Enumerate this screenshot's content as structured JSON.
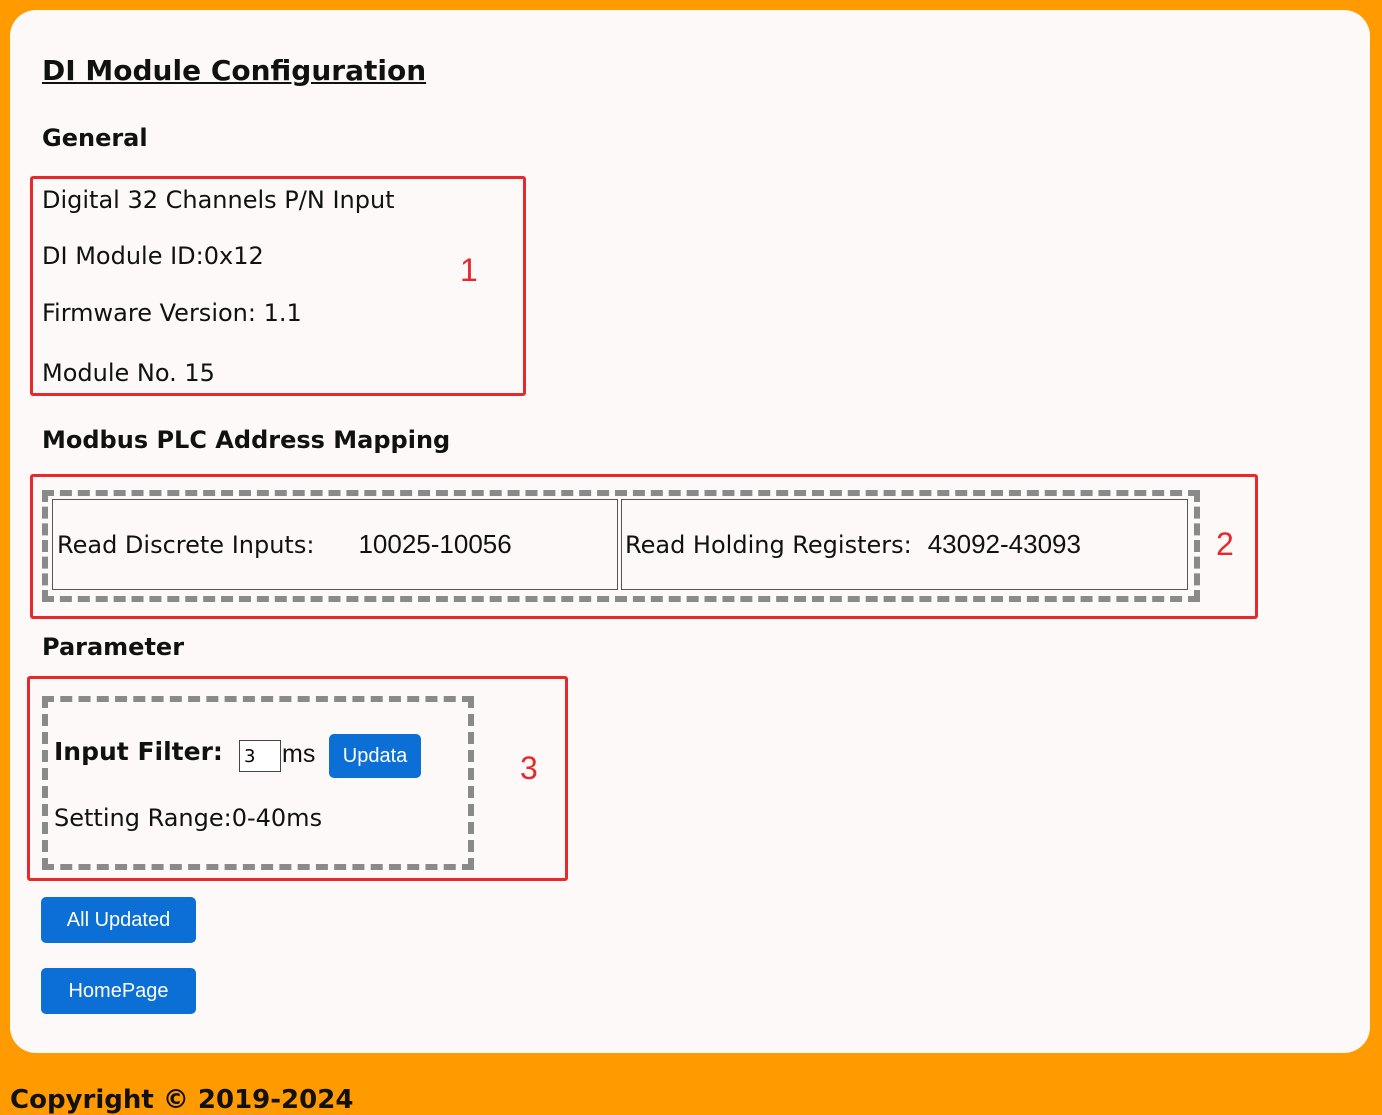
{
  "page_title": "DI Module Configuration",
  "general": {
    "heading": "General",
    "lines": [
      "Digital 32 Channels P/N Input",
      "DI Module ID:0x12",
      "Firmware Version: 1.1",
      "Module No. 15"
    ],
    "annotation": "1"
  },
  "mapping": {
    "heading": "Modbus PLC Address Mapping",
    "discrete_label": "Read Discrete Inputs:",
    "discrete_value": "10025-10056",
    "holding_label": "Read Holding Registers:",
    "holding_value": "43092-43093",
    "annotation": "2"
  },
  "parameter": {
    "heading": "Parameter",
    "filter_label": "Input Filter:",
    "filter_value": "3",
    "unit": "ms",
    "update_button": "Updata",
    "range": "Setting Range:0-40ms",
    "annotation": "3"
  },
  "buttons": {
    "all_updated": "All Updated",
    "homepage": "HomePage"
  },
  "footer": "Copyright © 2019-2024",
  "colors": {
    "background": "#ff9a00",
    "panel": "#fdf9f8",
    "button": "#0b6fd6",
    "annotation": "#e8292c"
  }
}
